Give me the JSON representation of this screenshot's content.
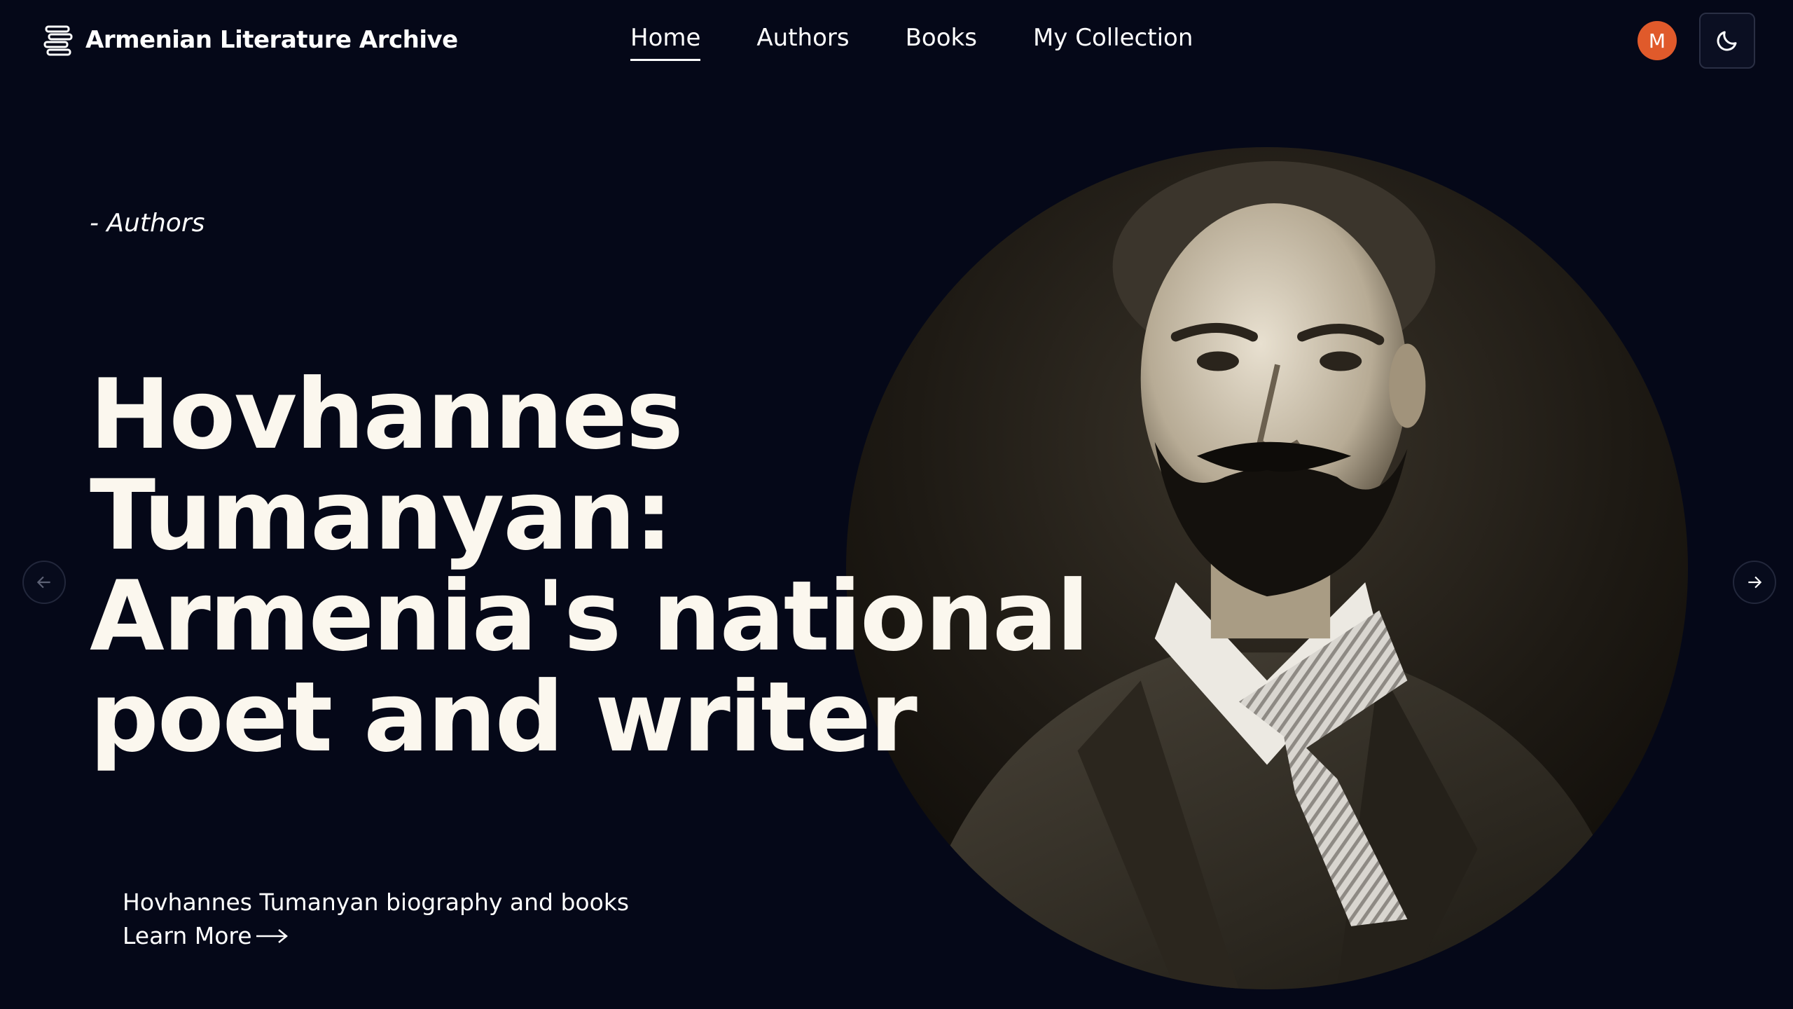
{
  "nav": {
    "brand": {
      "label": "Armenian Literature Archive",
      "icon": "book-stack-icon"
    },
    "links": [
      {
        "label": "Home",
        "active": true
      },
      {
        "label": "Authors",
        "active": false
      },
      {
        "label": "Books",
        "active": false
      },
      {
        "label": "My Collection",
        "active": false
      }
    ],
    "avatar_initial": "M",
    "avatar_color": "#e05a2b",
    "theme_toggle_icon": "moon-icon"
  },
  "hero": {
    "eyebrow": "- Authors",
    "headline_lines": [
      "Hovhannes",
      "Tumanyan:",
      "Armenia's national",
      "poet and writer"
    ],
    "subtitle": "Hovhannes Tumanyan biography and books",
    "cta_label": "Learn More",
    "cta_icon": "long-arrow-right-icon",
    "image": "sepia-portrait-bearded-man-in-bow-tie"
  },
  "carousel": {
    "prev_icon": "arrow-left-icon",
    "next_icon": "arrow-right-icon"
  },
  "colors": {
    "background": "#050818",
    "headline": "#fbf7ee",
    "accent_avatar": "#e05a2b"
  }
}
